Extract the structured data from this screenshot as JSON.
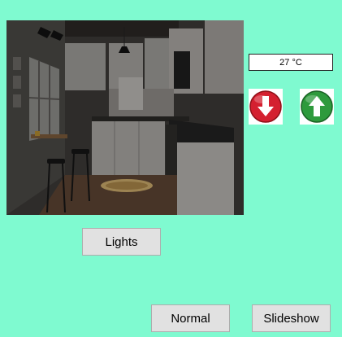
{
  "temperature": {
    "display": "27 °C"
  },
  "controls": {
    "decrease_icon": "red-down-arrow",
    "increase_icon": "green-up-arrow"
  },
  "buttons": {
    "lights": "Lights",
    "normal": "Normal",
    "slideshow": "Slideshow"
  },
  "colors": {
    "background": "#7ffad0",
    "button": "#e1e1e1",
    "decrease": "#d42030",
    "increase": "#2e9a3c"
  }
}
